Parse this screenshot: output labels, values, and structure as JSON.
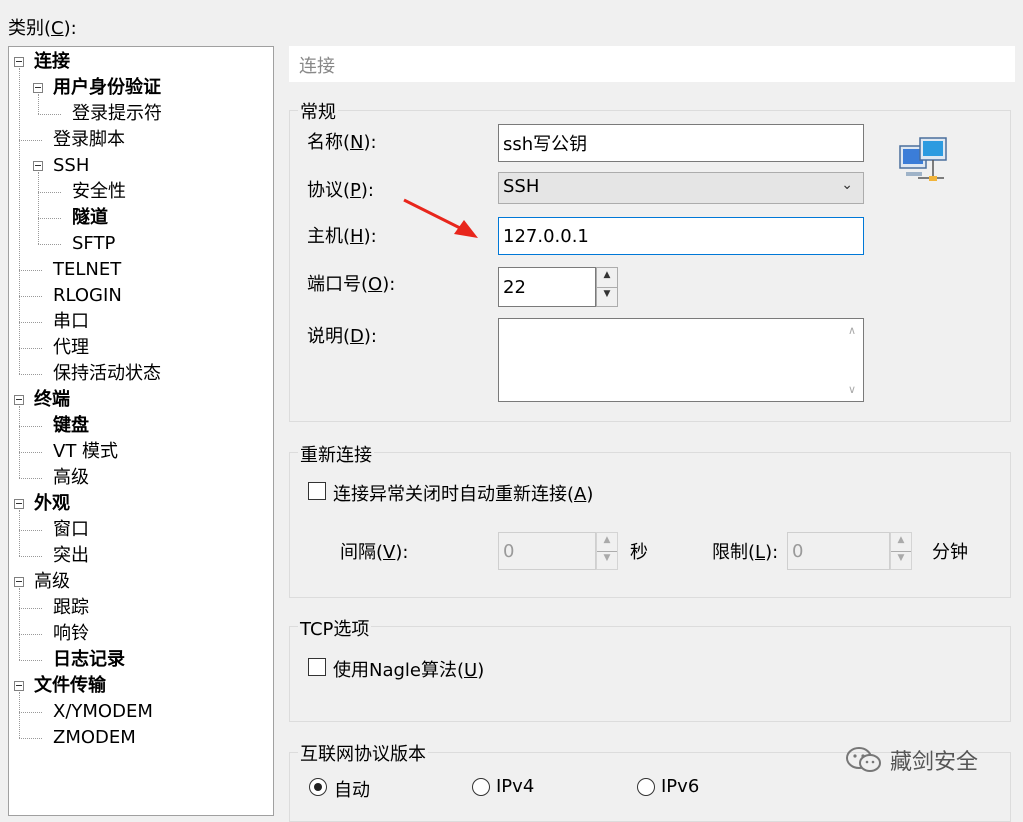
{
  "category": {
    "label": "类别",
    "accel": "C",
    "suffix": "):"
  },
  "tree": [
    {
      "label": "连接",
      "level": 0,
      "bold": true,
      "toggle": true
    },
    {
      "label": "用户身份验证",
      "level": 1,
      "bold": true,
      "toggle": true
    },
    {
      "label": "登录提示符",
      "level": 2,
      "bold": false,
      "toggle": false
    },
    {
      "label": "登录脚本",
      "level": 1,
      "bold": false,
      "toggle": false
    },
    {
      "label": "SSH",
      "level": 1,
      "bold": false,
      "toggle": true
    },
    {
      "label": "安全性",
      "level": 2,
      "bold": false,
      "toggle": false
    },
    {
      "label": "隧道",
      "level": 2,
      "bold": true,
      "toggle": false
    },
    {
      "label": "SFTP",
      "level": 2,
      "bold": false,
      "toggle": false
    },
    {
      "label": "TELNET",
      "level": 1,
      "bold": false,
      "toggle": false
    },
    {
      "label": "RLOGIN",
      "level": 1,
      "bold": false,
      "toggle": false
    },
    {
      "label": "串口",
      "level": 1,
      "bold": false,
      "toggle": false
    },
    {
      "label": "代理",
      "level": 1,
      "bold": false,
      "toggle": false
    },
    {
      "label": "保持活动状态",
      "level": 1,
      "bold": false,
      "toggle": false
    },
    {
      "label": "终端",
      "level": 0,
      "bold": true,
      "toggle": true
    },
    {
      "label": "键盘",
      "level": 1,
      "bold": true,
      "toggle": false
    },
    {
      "label": "VT 模式",
      "level": 1,
      "bold": false,
      "toggle": false
    },
    {
      "label": "高级",
      "level": 1,
      "bold": false,
      "toggle": false
    },
    {
      "label": "外观",
      "level": 0,
      "bold": true,
      "toggle": true
    },
    {
      "label": "窗口",
      "level": 1,
      "bold": false,
      "toggle": false
    },
    {
      "label": "突出",
      "level": 1,
      "bold": false,
      "toggle": false
    },
    {
      "label": "高级",
      "level": 0,
      "bold": false,
      "toggle": true
    },
    {
      "label": "跟踪",
      "level": 1,
      "bold": false,
      "toggle": false
    },
    {
      "label": "响铃",
      "level": 1,
      "bold": false,
      "toggle": false
    },
    {
      "label": "日志记录",
      "level": 1,
      "bold": true,
      "toggle": false
    },
    {
      "label": "文件传输",
      "level": 0,
      "bold": true,
      "toggle": true
    },
    {
      "label": "X/YMODEM",
      "level": 1,
      "bold": false,
      "toggle": false
    },
    {
      "label": "ZMODEM",
      "level": 1,
      "bold": false,
      "toggle": false
    }
  ],
  "header": {
    "title": "连接"
  },
  "general": {
    "title": "常规",
    "name_label": "名称",
    "name_accel": "N",
    "name_value": "ssh写公钥",
    "protocol_label": "协议",
    "protocol_accel": "P",
    "protocol_value": "SSH",
    "host_label": "主机",
    "host_accel": "H",
    "host_value": "127.0.0.1",
    "port_label": "端口号",
    "port_accel": "O",
    "port_value": "22",
    "desc_label": "说明",
    "desc_accel": "D",
    "desc_value": ""
  },
  "reconnect": {
    "title": "重新连接",
    "auto_label": "连接异常关闭时自动重新连接",
    "auto_accel": "A",
    "interval_label": "间隔",
    "interval_accel": "V",
    "interval_value": "0",
    "interval_unit": "秒",
    "limit_label": "限制",
    "limit_accel": "L",
    "limit_value": "0",
    "limit_unit": "分钟"
  },
  "tcp": {
    "title": "TCP选项",
    "nagle_label": "使用Nagle算法",
    "nagle_accel": "U"
  },
  "ipver": {
    "title": "互联网协议版本",
    "options": [
      "自动",
      "IPv4",
      "IPv6"
    ],
    "selected": 0
  },
  "watermark": {
    "text": "藏剑安全"
  },
  "colors": {
    "focus": "#0078d7",
    "arrow": "#e8261c"
  }
}
